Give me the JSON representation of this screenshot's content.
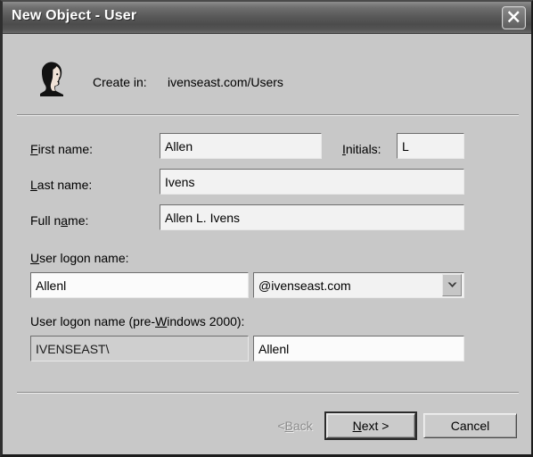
{
  "window": {
    "title": "New Object - User",
    "close_icon": "close-icon"
  },
  "header": {
    "icon": "user-head-icon",
    "create_in_label": "Create in:",
    "create_in_value": "ivenseast.com/Users"
  },
  "form": {
    "first_name": {
      "label_pre": "",
      "label_accel": "F",
      "label_post": "irst name:",
      "value": "Allen"
    },
    "initials": {
      "label_pre": "",
      "label_accel": "I",
      "label_post": "nitials:",
      "value": "L"
    },
    "last_name": {
      "label_pre": "",
      "label_accel": "L",
      "label_post": "ast name:",
      "value": "Ivens"
    },
    "full_name": {
      "label_pre": "Full n",
      "label_accel": "a",
      "label_post": "me:",
      "value": "Allen L. Ivens"
    },
    "user_logon": {
      "label_pre": "",
      "label_accel": "U",
      "label_post": "ser logon name:",
      "value": "Allenl",
      "suffix_value": "@ivenseast.com",
      "suffix_icon": "chevron-down-icon"
    },
    "user_logon_pre2000": {
      "label_pre": "User logon name (pre-",
      "label_accel": "W",
      "label_post": "indows 2000):",
      "domain_value": "IVENSEAST\\",
      "value": "Allenl"
    }
  },
  "buttons": {
    "back": {
      "pre": "< ",
      "accel": "B",
      "post": "ack",
      "enabled": false
    },
    "next": {
      "pre": "",
      "accel": "N",
      "post": "ext >",
      "enabled": true,
      "is_default": true
    },
    "cancel": {
      "pre": "Cancel",
      "accel": "",
      "post": "",
      "enabled": true
    }
  }
}
